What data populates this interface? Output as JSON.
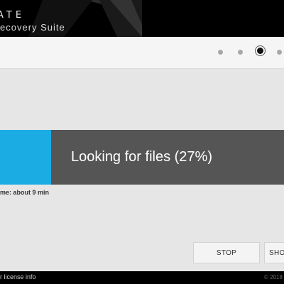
{
  "header": {
    "brand_top": "ATE",
    "brand_sub": "ecovery Suite"
  },
  "steps": {
    "count": 4,
    "active_index": 2
  },
  "progress": {
    "percent": 27,
    "label": "Looking for files (27%)",
    "time_left": "me: about 9 min",
    "fill_color": "#1aace3",
    "track_color": "#555555"
  },
  "buttons": {
    "stop_label": "STOP",
    "show_label": "SHO"
  },
  "footer": {
    "license_text": "r license info",
    "copyright": "© 2018 S"
  }
}
